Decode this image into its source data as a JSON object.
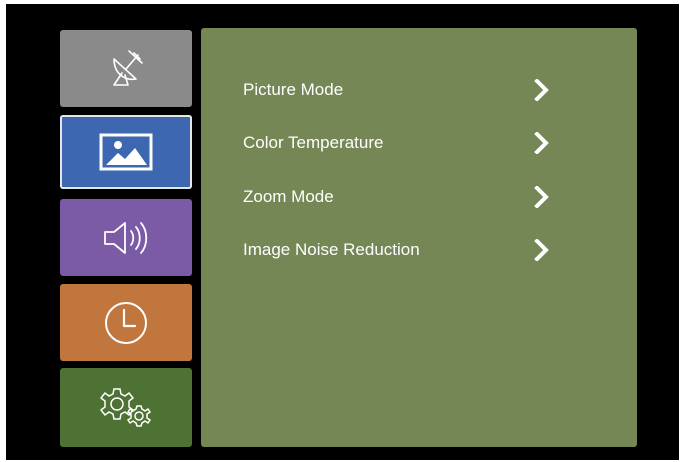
{
  "sidebar": {
    "tabs": [
      {
        "id": "antenna",
        "icon": "satellite-dish-icon",
        "color": "#8a8a8a",
        "selected": false
      },
      {
        "id": "picture",
        "icon": "picture-icon",
        "color": "#3e67b1",
        "selected": true
      },
      {
        "id": "sound",
        "icon": "speaker-icon",
        "color": "#7b5aa6",
        "selected": false
      },
      {
        "id": "timer",
        "icon": "clock-icon",
        "color": "#c0763d",
        "selected": false
      },
      {
        "id": "setup",
        "icon": "gears-icon",
        "color": "#4e7234",
        "selected": false
      }
    ]
  },
  "menu": {
    "panel_color": "#748755",
    "items": [
      {
        "label": "Picture Mode",
        "arrow_icon": "chevron-right-icon"
      },
      {
        "label": "Color Temperature",
        "arrow_icon": "chevron-right-icon"
      },
      {
        "label": "Zoom Mode",
        "arrow_icon": "chevron-right-icon"
      },
      {
        "label": "Image Noise Reduction",
        "arrow_icon": "chevron-right-icon"
      }
    ]
  }
}
